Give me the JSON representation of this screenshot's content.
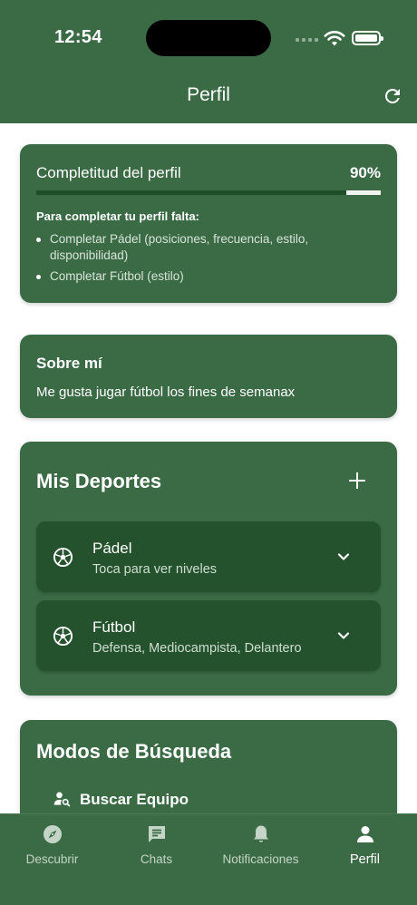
{
  "status_bar": {
    "time": "12:54"
  },
  "header": {
    "title": "Perfil",
    "refresh_icon": "refresh-icon"
  },
  "completeness": {
    "label": "Completitud del perfil",
    "percent_text": "90%",
    "progress_fraction": 0.9,
    "missing_title": "Para completar tu perfil falta:",
    "items": [
      "Completar Pádel (posiciones, frecuencia, estilo, disponibilidad)",
      "Completar Fútbol (estilo)"
    ]
  },
  "about": {
    "title": "Sobre mí",
    "text": "Me gusta jugar fútbol los fines de semanax"
  },
  "sports": {
    "title": "Mis Deportes",
    "add_icon": "plus-icon",
    "items": [
      {
        "name": "Pádel",
        "subtitle": "Toca para ver niveles"
      },
      {
        "name": "Fútbol",
        "subtitle": "Defensa, Mediocampista, Delantero"
      }
    ]
  },
  "search_modes": {
    "title": "Modos de Búsqueda",
    "items": [
      {
        "label": "Buscar Equipo",
        "icon": "person-search-icon"
      }
    ]
  },
  "bottom_nav": {
    "items": [
      {
        "label": "Descubrir",
        "icon": "compass-icon"
      },
      {
        "label": "Chats",
        "icon": "chat-icon"
      },
      {
        "label": "Notificaciones",
        "icon": "bell-icon"
      },
      {
        "label": "Perfil",
        "icon": "person-icon",
        "active": true
      }
    ]
  },
  "colors": {
    "primary": "#3b6b45",
    "dark": "#24522d",
    "progress_fill": "#1f4d28"
  }
}
